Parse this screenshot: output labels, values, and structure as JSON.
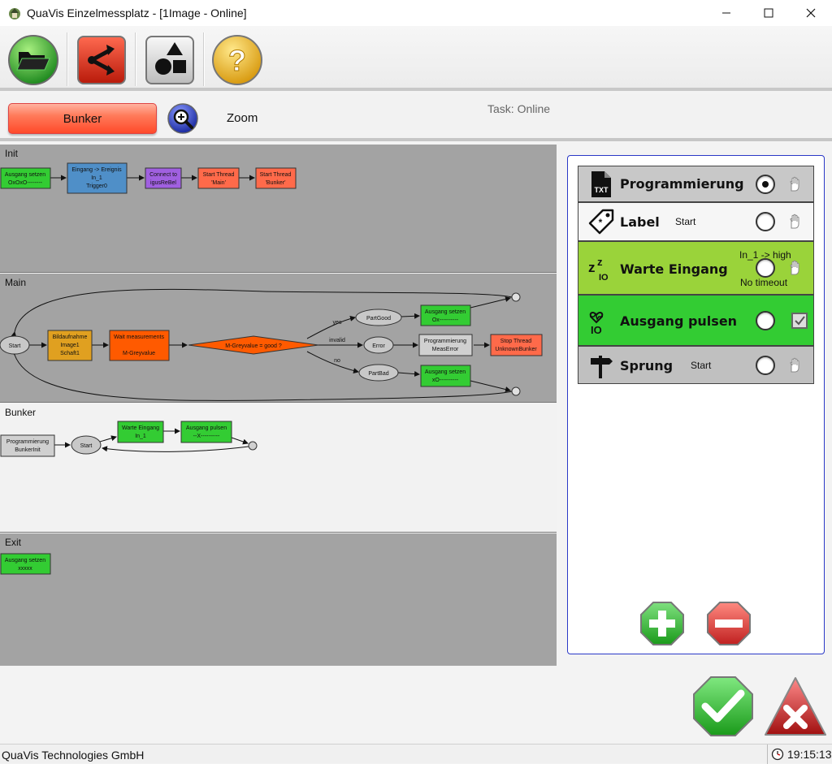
{
  "window": {
    "title": "QuaVis Einzelmessplatz -  [1Image - Online]"
  },
  "toolbar": {
    "buttons": [
      {
        "icon": "folder-open-icon"
      },
      {
        "icon": "flow-branch-icon"
      },
      {
        "icon": "shapes-icon"
      },
      {
        "icon": "help-icon"
      }
    ]
  },
  "header": {
    "bunker_label": "Bunker",
    "zoom_label": "Zoom",
    "task_label": "Task: Online"
  },
  "sections": {
    "init": {
      "title": "Init",
      "nodes": [
        {
          "l1": "Ausgang setzen",
          "l2": "OxOxO--------"
        },
        {
          "l1": "Eingang -> Ereignis",
          "l2": "In_1",
          "l3": "Trigger0"
        },
        {
          "l1": "Connect to",
          "l2": "igusReBel"
        },
        {
          "l1": "Start Thread",
          "l2": "'Main'"
        },
        {
          "l1": "Start Thread",
          "l2": "'Bunker'"
        }
      ]
    },
    "main": {
      "title": "Main",
      "start": "Start",
      "bild": {
        "l1": "Bildaufnahme",
        "l2": "Image1",
        "l3": "Schaft1"
      },
      "wait": {
        "l1": "Wait measurements",
        "l2": "M-Greyvalue"
      },
      "decision": "M-Greyvalue = good ?",
      "edge_yes": "yes",
      "edge_invalid": "invalid",
      "edge_no": "no",
      "part_good": "PartGood",
      "error": "Error",
      "part_bad": "PartBad",
      "out_good": {
        "l1": "Ausgang setzen",
        "l2": "Ox----------"
      },
      "prog_error": {
        "l1": "Programmierung",
        "l2": "MeasError"
      },
      "stop": {
        "l1": "Stop Thread",
        "l2": "UnknownBunker"
      },
      "out_bad": {
        "l1": "Ausgang setzen",
        "l2": "xO----------"
      }
    },
    "bunker": {
      "title": "Bunker",
      "prog": {
        "l1": "Programmierung",
        "l2": "BunkerInit"
      },
      "start": "Start",
      "wait": {
        "l1": "Warte Eingang",
        "l2": "In_1"
      },
      "pulse": {
        "l1": "Ausgang pulsen",
        "l2": "--X----------"
      }
    },
    "exit": {
      "title": "Exit",
      "out": {
        "l1": "Ausgang setzen",
        "l2": "xxxxx"
      }
    }
  },
  "panel": {
    "items": [
      {
        "name": "Programmierung",
        "icon": "txt-file-icon",
        "sub": "",
        "color": "#c8c8c8",
        "selected": true,
        "right": "hand"
      },
      {
        "name": "Label",
        "icon": "label-tag-icon",
        "sub": "Start",
        "color": "#f4f4f4",
        "selected": false,
        "right": "hand"
      },
      {
        "name": "Warte Eingang",
        "icon": "sleep-io-icon",
        "sub1": "In_1 -> high",
        "sub2": "No timeout",
        "color": "#9ad33a",
        "selected": false,
        "right": "hand"
      },
      {
        "name": "Ausgang pulsen",
        "icon": "pulse-io-icon",
        "sub": "",
        "color": "#33cc33",
        "selected": false,
        "right": "checkbox"
      },
      {
        "name": "Sprung",
        "icon": "signpost-icon",
        "sub": "Start",
        "color": "#c0c0c0",
        "selected": false,
        "right": "hand"
      }
    ]
  },
  "status": {
    "company": "QuaVis Technologies GmbH",
    "time": "19:15:13"
  },
  "colors": {
    "green_node": "#33cc33",
    "blue_node": "#4f8fc8",
    "purple_node": "#a060e0",
    "red_node": "#ff6a4a",
    "orange_node": "#ff5a00",
    "gold_node": "#e0a020",
    "gray_node": "#d0d0d0"
  }
}
